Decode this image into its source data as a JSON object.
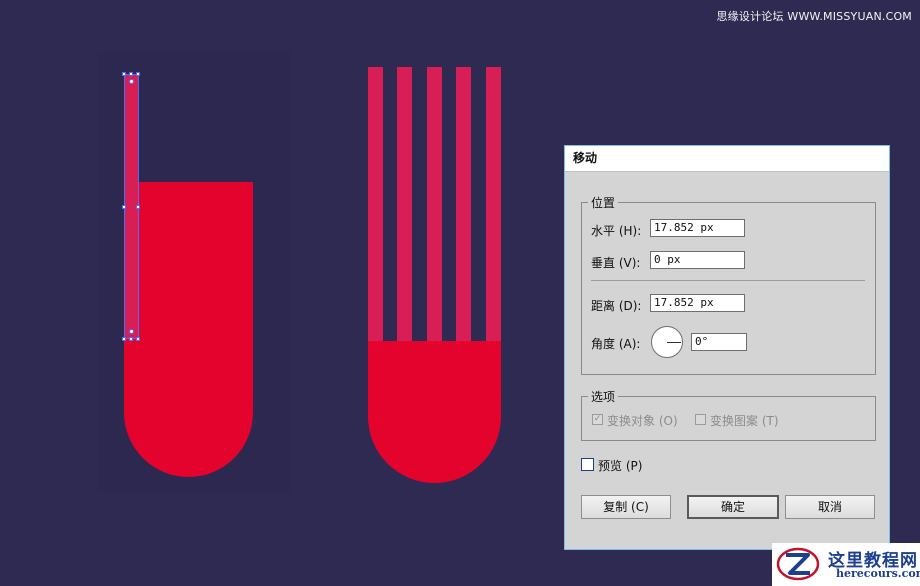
{
  "watermark": "思缘设计论坛 WWW.MISSYUAN.COM",
  "dialog": {
    "title": "移动",
    "position_group": "位置",
    "horizontal_label": "水平 (H):",
    "horizontal_value": "17.852 px",
    "vertical_label": "垂直 (V):",
    "vertical_value": "0 px",
    "distance_label": "距离 (D):",
    "distance_value": "17.852 px",
    "angle_label": "角度 (A):",
    "angle_value": "0°",
    "options_group": "选项",
    "transform_objects_label": "变换对象 (O)",
    "transform_objects_checked": true,
    "transform_patterns_label": "变换图案 (T)",
    "transform_patterns_checked": false,
    "preview_label": "预览 (P)",
    "preview_checked": false,
    "copy_button": "复制 (C)",
    "ok_button": "确定",
    "cancel_button": "取消"
  },
  "logo": {
    "cn": "这里教程网",
    "en": "herecours.com"
  },
  "colors": {
    "background": "#2f2a52",
    "shape_red": "#e4032c",
    "stripe_pink": "#d71f55",
    "selection": "#4d6cff"
  }
}
